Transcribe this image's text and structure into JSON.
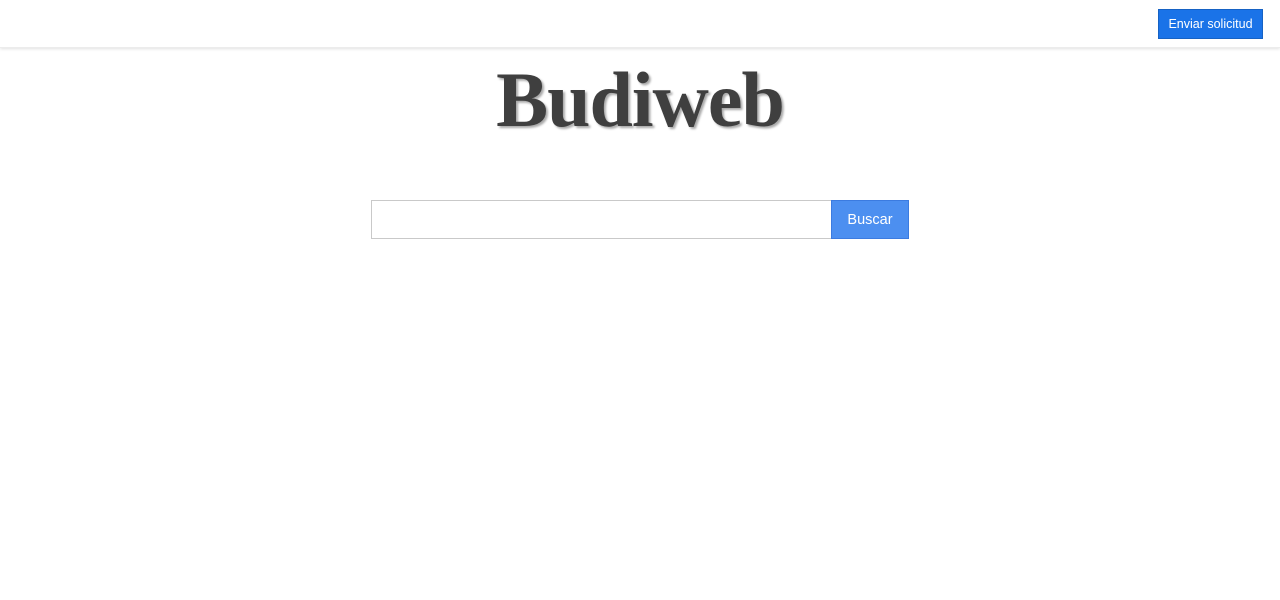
{
  "header": {
    "request_button_label": "Enviar solicitud"
  },
  "logo": {
    "text": "Budiweb"
  },
  "search": {
    "value": "",
    "placeholder": "",
    "button_label": "Buscar"
  },
  "colors": {
    "primary_button": "#1a73e8",
    "search_button": "#4c8ff0",
    "logo_text": "#3f3f3f"
  }
}
